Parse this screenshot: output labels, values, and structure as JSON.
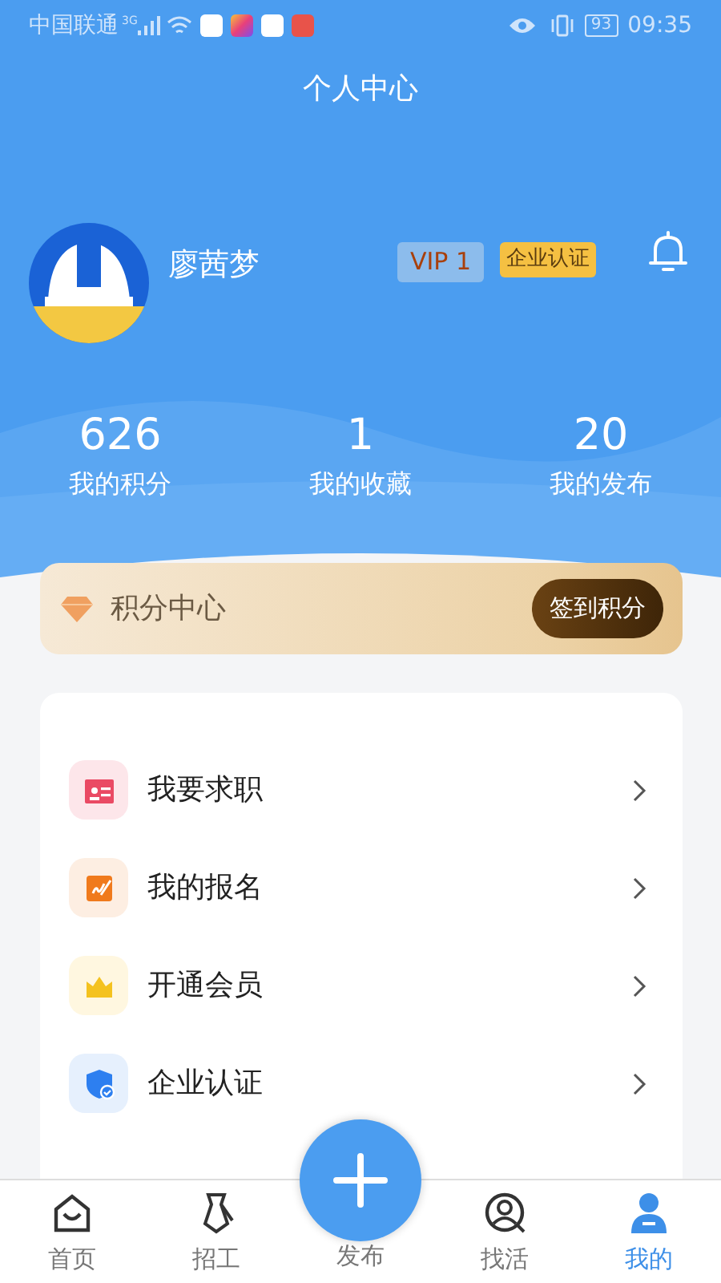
{
  "status_bar": {
    "carrier": "中国联通",
    "network": "3G",
    "battery": "93",
    "time": "09:35"
  },
  "window": {
    "title": "个人中心"
  },
  "profile": {
    "name": "廖茜梦",
    "vip_badge": "VIP 1",
    "verified_badge": "企业认证"
  },
  "stats": [
    {
      "value": "626",
      "label": "我的积分"
    },
    {
      "value": "1",
      "label": "我的收藏"
    },
    {
      "value": "20",
      "label": "我的发布"
    }
  ],
  "points_card": {
    "title": "积分中心",
    "button": "签到积分"
  },
  "menu": [
    {
      "kind": "resume",
      "label": "我要求职"
    },
    {
      "kind": "signup",
      "label": "我的报名"
    },
    {
      "kind": "vip",
      "label": "开通会员"
    },
    {
      "kind": "company",
      "label": "企业认证"
    }
  ],
  "tab_bar": [
    {
      "kind": "home",
      "label": "首页",
      "selected": false
    },
    {
      "kind": "hire",
      "label": "招工",
      "selected": false
    },
    {
      "kind": "publish",
      "label": "发布",
      "selected": false
    },
    {
      "kind": "find",
      "label": "找活",
      "selected": false
    },
    {
      "kind": "me",
      "label": "我的",
      "selected": true
    }
  ]
}
